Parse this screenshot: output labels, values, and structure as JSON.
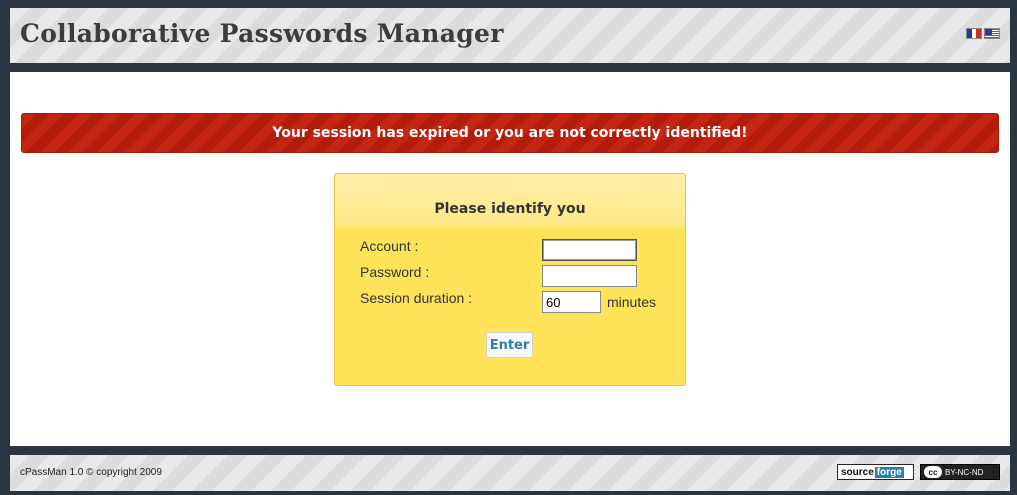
{
  "header": {
    "title": "Collaborative Passwords Manager",
    "flags": [
      "flag-fr-icon",
      "flag-us-icon"
    ]
  },
  "alert": {
    "message": "Your session has expired or you are not correctly identified!"
  },
  "login": {
    "title": "Please identify you",
    "account_label": "Account :",
    "account_value": "",
    "password_label": "Password :",
    "password_value": "",
    "session_label": "Session duration :",
    "session_value": "60",
    "session_unit": "minutes",
    "enter_label": "Enter"
  },
  "footer": {
    "copyright": "cPassMan 1.0 © copyright 2009",
    "sourceforge_a": "source",
    "sourceforge_b": "forge",
    "cc_symbol": "cc",
    "cc_license": "BY-NC-ND"
  },
  "colors": {
    "background": "#2a3540",
    "alert": "#c42612",
    "login_box": "#ffe45a",
    "enter_text": "#2a7fb0"
  }
}
